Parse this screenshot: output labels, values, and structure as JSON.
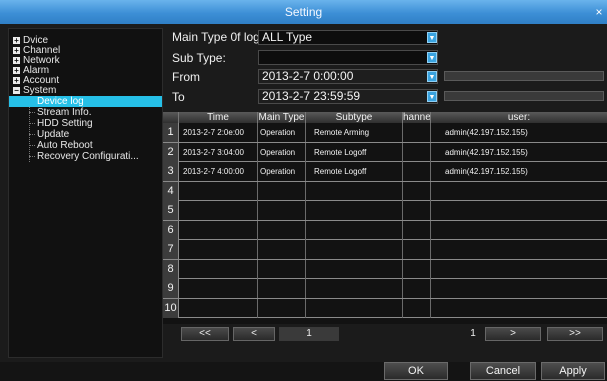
{
  "window": {
    "title": "Setting",
    "close_icon": "close-icon"
  },
  "sidebar": {
    "items": [
      {
        "label": "Dvice",
        "icon": "plus-box-icon"
      },
      {
        "label": "Channel",
        "icon": "plus-box-icon"
      },
      {
        "label": "Network",
        "icon": "plus-box-icon"
      },
      {
        "label": "Alarm",
        "icon": "plus-box-icon"
      },
      {
        "label": "Account",
        "icon": "plus-box-icon"
      },
      {
        "label": "System",
        "icon": "minus-box-icon"
      }
    ],
    "expand_glyph": "+",
    "collapse_glyph": "−",
    "subitems": [
      {
        "label": "Device log",
        "active": true
      },
      {
        "label": "Stream Info."
      },
      {
        "label": "HDD Setting"
      },
      {
        "label": "Update"
      },
      {
        "label": "Auto Reboot"
      },
      {
        "label": "Recovery Configurati..."
      }
    ]
  },
  "filters": {
    "main_type_label": "Main Type 0f log:",
    "main_type_value": "ALL Type",
    "sub_type_label": "Sub Type:",
    "sub_type_value": "",
    "from_label": "From",
    "from_value": "2013-2-7 0:00:00",
    "to_label": "To",
    "to_value": "2013-2-7 23:59:59",
    "dropdown_glyph": "▼"
  },
  "table": {
    "columns": [
      "Time",
      "Main Type",
      "Subtype",
      "hanne",
      "user:"
    ],
    "row_numbers": [
      "1",
      "2",
      "3",
      "4",
      "5",
      "6",
      "7",
      "8",
      "9",
      "10"
    ],
    "rows": [
      {
        "time": "2013-2-7 2:0e:00",
        "main_type": "Operation",
        "subtype": "Remote Arming",
        "channel": "",
        "user": "admin(42.197.152.155)"
      },
      {
        "time": "2013-2-7 3:04:00",
        "main_type": "Operation",
        "subtype": "Remote Logoff",
        "channel": "",
        "user": "admin(42.197.152.155)"
      },
      {
        "time": "2013-2-7 4:00:00",
        "main_type": "Operation",
        "subtype": "Remote Logoff",
        "channel": "",
        "user": "admin(42.197.152.155)"
      }
    ]
  },
  "pager": {
    "first_label": "<<",
    "prev_label": "<",
    "current_page": "1",
    "total_pages": "1",
    "next_label": ">",
    "last_label": ">>"
  },
  "actions": {
    "ok_label": "OK",
    "cancel_label": "Cancel",
    "apply_label": "Apply"
  },
  "colors": {
    "title_blue": "#3d8fd6",
    "highlight_cyan": "#26c0e8",
    "dropdown_blue": "#3aa3df"
  }
}
